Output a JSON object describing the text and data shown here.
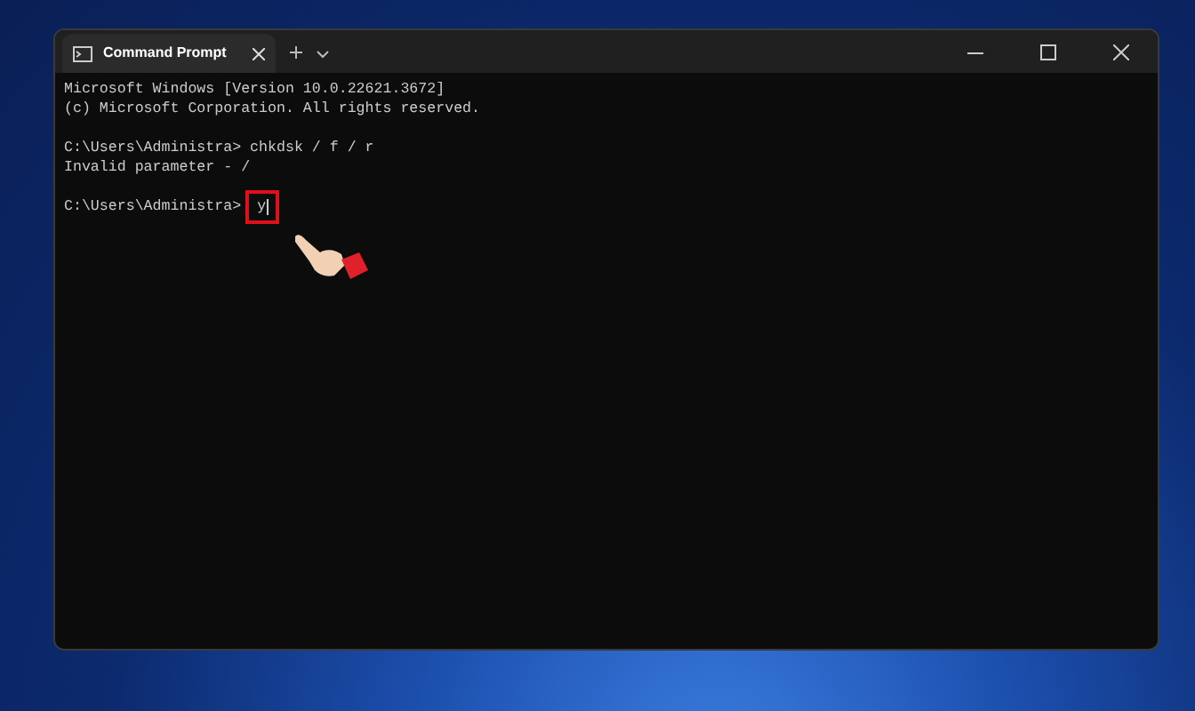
{
  "window": {
    "tab_title": "Command Prompt"
  },
  "terminal": {
    "lines": [
      {
        "kind": "text",
        "text": "Microsoft Windows [Version 10.0.22621.3672]"
      },
      {
        "kind": "text",
        "text": "(c) Microsoft Corporation. All rights reserved."
      },
      {
        "kind": "blank"
      },
      {
        "kind": "text",
        "text": "C:\\Users\\Administra> chkdsk / f / r"
      },
      {
        "kind": "text",
        "text": "Invalid parameter - /"
      },
      {
        "kind": "blank"
      }
    ],
    "prompt": "C:\\Users\\Administra>",
    "input": "y",
    "input_highlighted": true
  }
}
